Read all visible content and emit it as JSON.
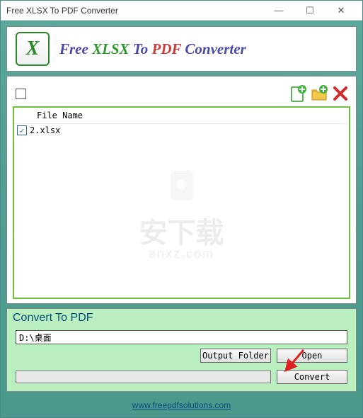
{
  "window": {
    "title": "Free XLSX To PDF Converter"
  },
  "header": {
    "prefix": "Free ",
    "xlsx": "XLSX",
    "mid": " To ",
    "pdf": "PDF",
    "suffix": " Converter"
  },
  "toolbar": {
    "add_file": "add-file",
    "add_folder": "add-folder",
    "remove": "remove"
  },
  "list": {
    "header": "File Name",
    "rows": [
      {
        "checked": true,
        "name": "2.xlsx"
      }
    ]
  },
  "watermark": {
    "main": "安下载",
    "sub": "anxz.com"
  },
  "convert": {
    "label": "Convert To PDF",
    "path": "D:\\桌面",
    "output_folder_btn": "Output Folder",
    "open_btn": "Open",
    "convert_btn": "Convert"
  },
  "footer": {
    "link_text": "www.freepdfsolutions.com"
  }
}
